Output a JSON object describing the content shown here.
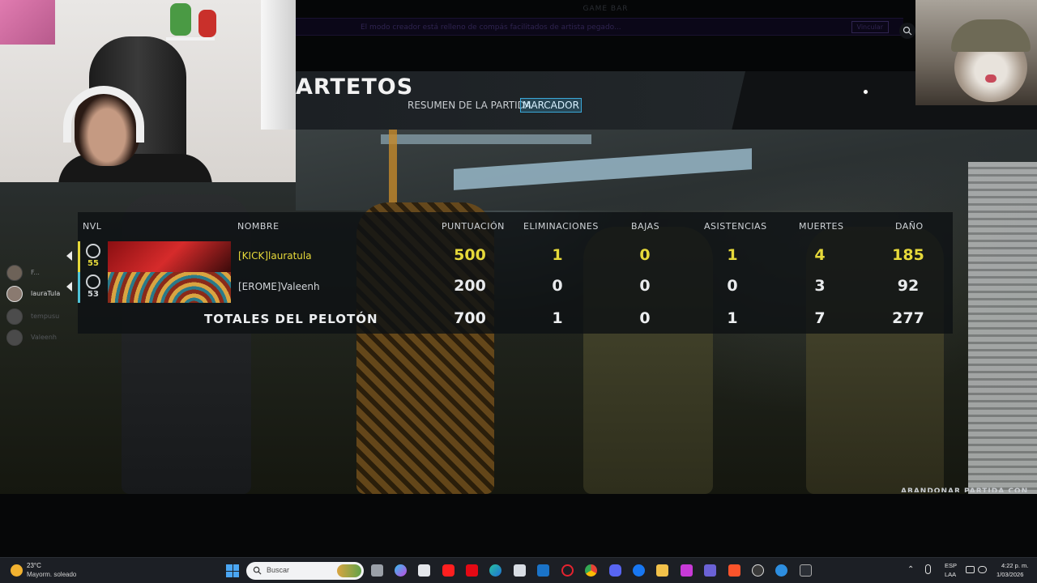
{
  "overlay": {
    "game_bar_title": "GAME BAR",
    "notice_text": "El modo creador está relleno de compás facilitados de artista pegado...",
    "notice_button": "Vincular"
  },
  "header": {
    "mode_title": "ARTETOS",
    "tabs": [
      {
        "label": "RESUMEN DE LA PARTIDA",
        "active": false
      },
      {
        "label": "MARCADOR",
        "active": true
      }
    ],
    "accent_color": "#3aa7d8"
  },
  "scoreboard": {
    "columns": {
      "level": "NVL",
      "name": "NOMBRE",
      "score": "PUNTUACIÓN",
      "eliminations": "ELIMINACIONES",
      "kills": "BAJAS",
      "assists": "ASISTENCIAS",
      "deaths": "MUERTES",
      "damage": "DAÑO"
    },
    "players": [
      {
        "level": "55",
        "name": "[KICK]lauratula",
        "score": "500",
        "eliminations": "1",
        "kills": "0",
        "assists": "1",
        "deaths": "4",
        "damage": "185",
        "highlight_color": "#e6d93a"
      },
      {
        "level": "53",
        "name": "[EROME]Valeenh",
        "score": "200",
        "eliminations": "0",
        "kills": "0",
        "assists": "0",
        "deaths": "3",
        "damage": "92",
        "highlight_color": "#4fc3d8"
      }
    ],
    "totals": {
      "label": "TOTALES DEL PELOTÓN",
      "score": "700",
      "eliminations": "1",
      "kills": "0",
      "assists": "1",
      "deaths": "7",
      "damage": "277"
    }
  },
  "voice_list": [
    {
      "name": "F..."
    },
    {
      "name": "lauraTula"
    },
    {
      "name": "tempusu"
    },
    {
      "name": "Valeenh"
    }
  ],
  "footer": {
    "abandon_label": "ABANDONAR PARTIDA CON"
  },
  "taskbar": {
    "weather_temp": "23°C",
    "weather_desc": "Mayorm. soleado",
    "search_placeholder": "Buscar",
    "lang_line1": "ESP",
    "lang_line2": "LAA",
    "time": "4:22 p. m.",
    "date": "1/03/2026",
    "apps": [
      "task-view-icon",
      "copilot-icon",
      "store-icon",
      "youtube-icon",
      "netflix-icon",
      "edge-icon",
      "feather-icon",
      "outlook-icon",
      "opera-icon",
      "chrome-icon",
      "discord-icon",
      "facebook-icon",
      "file-explorer-icon",
      "app-icon",
      "teams-icon",
      "brave-icon",
      "obs-icon",
      "xbox-icon",
      "terminal-icon"
    ]
  }
}
